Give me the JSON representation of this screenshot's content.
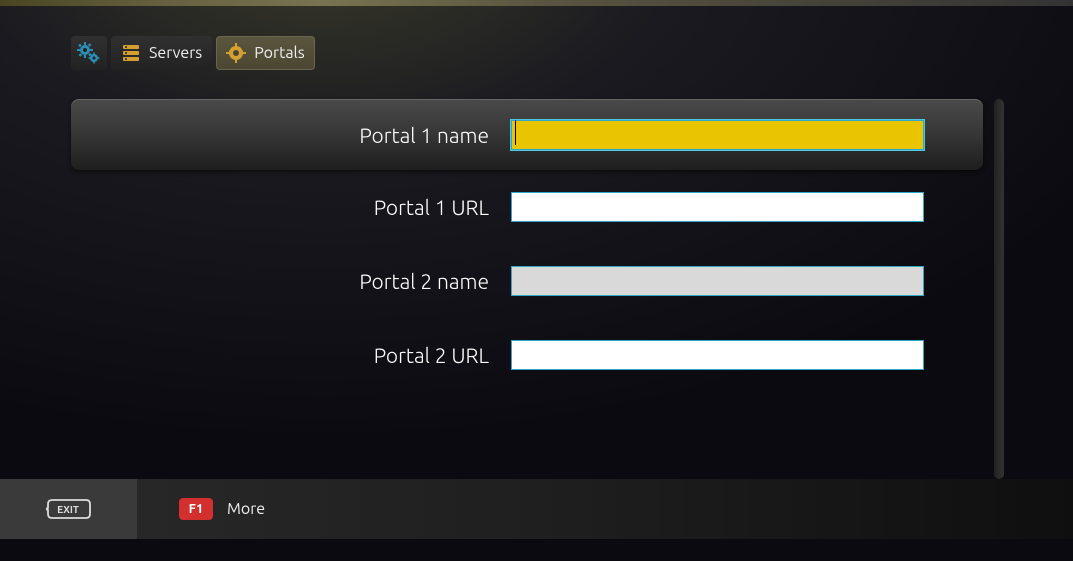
{
  "tabs": {
    "settings_icon": "settings-gears-icon",
    "servers": {
      "label": "Servers",
      "icon": "server-stack-icon"
    },
    "portals": {
      "label": "Portals",
      "icon": "portal-gear-icon"
    }
  },
  "form": {
    "rows": [
      {
        "label": "Portal 1 name",
        "value": "",
        "state": "focused"
      },
      {
        "label": "Portal 1 URL",
        "value": "",
        "state": "white"
      },
      {
        "label": "Portal 2 name",
        "value": "",
        "state": "grey"
      },
      {
        "label": "Portal 2 URL",
        "value": "",
        "state": "white"
      }
    ]
  },
  "footer": {
    "exit_label": "EXIT",
    "f1_label": "F1",
    "more_label": "More"
  },
  "colors": {
    "accent_yellow": "#e9c400",
    "border_cyan": "#2fa8c5",
    "f1_red": "#d32f2f"
  }
}
